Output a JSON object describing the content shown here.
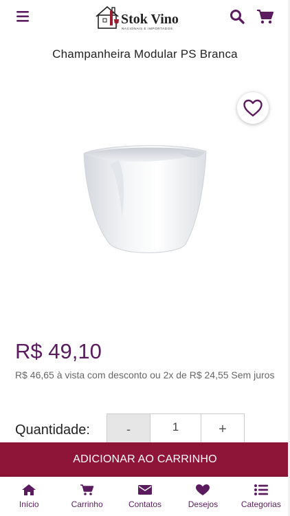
{
  "colors": {
    "brand_purple": "#5b1b5f",
    "add_to_cart_bg": "#8e1538",
    "wine_red": "#9b1c2e"
  },
  "header": {
    "logo_text": "Stok Vino",
    "logo_tagline": "NACIONAIS E IMPORTADOS",
    "menu_icon": "hamburger-icon",
    "search_icon": "search-icon",
    "cart_icon": "shopping-cart-icon"
  },
  "product": {
    "title": "Champanheira Modular PS Branca",
    "price": "R$ 49,10",
    "installment_text": "R$ 46,65 à vista com desconto ou 2x de R$ 24,55 Sem juros",
    "favorite_icon": "heart-outline-icon"
  },
  "quantity": {
    "label": "Quantidade:",
    "minus": "-",
    "value": "1",
    "plus": "+"
  },
  "add_to_cart": {
    "label": "ADICIONAR AO CARRINHO"
  },
  "bottom_nav": {
    "items": [
      {
        "label": "Início",
        "icon": "home-icon"
      },
      {
        "label": "Carrinho",
        "icon": "cart-icon"
      },
      {
        "label": "Contatos",
        "icon": "envelope-icon"
      },
      {
        "label": "Desejos",
        "icon": "heart-icon"
      },
      {
        "label": "Categorias",
        "icon": "list-icon"
      }
    ]
  }
}
